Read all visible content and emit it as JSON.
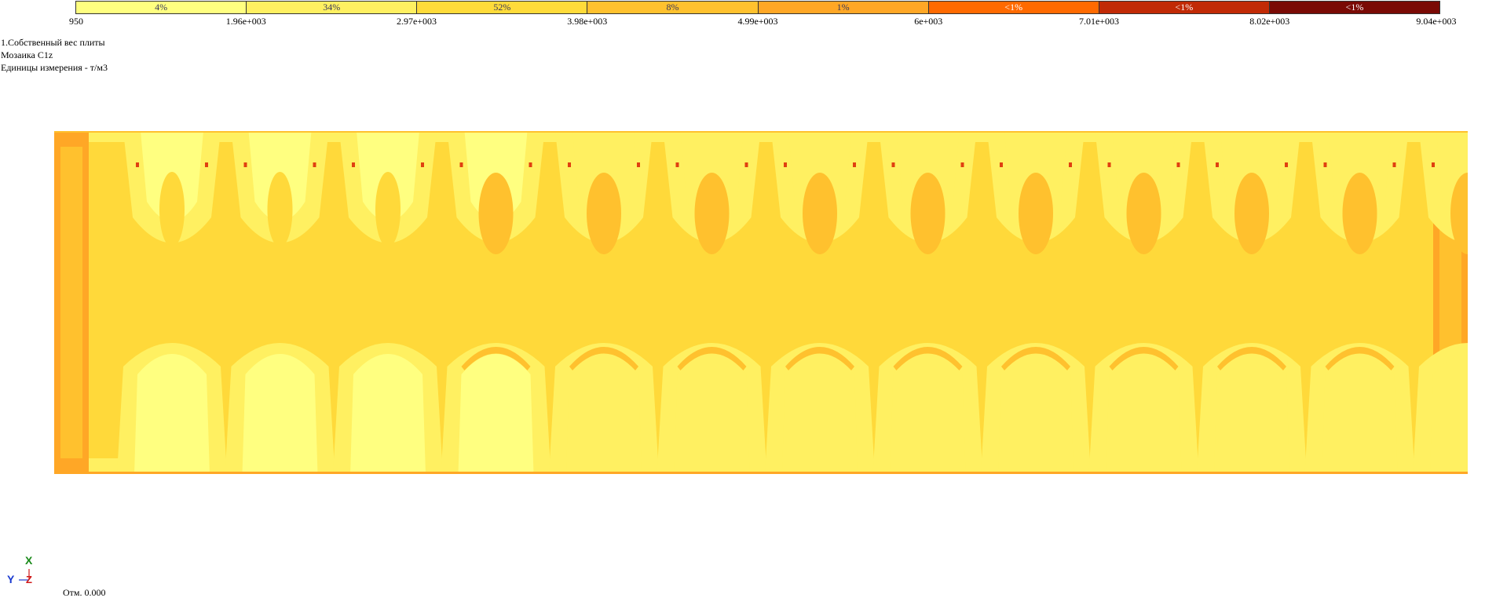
{
  "legend": {
    "segments": [
      {
        "percent": "4%",
        "color": "#FFFF80",
        "text_color": "#3a3a5a"
      },
      {
        "percent": "34%",
        "color": "#FFF061",
        "text_color": "#3a3a5a"
      },
      {
        "percent": "52%",
        "color": "#FFDB3A",
        "text_color": "#3a3a5a"
      },
      {
        "percent": "8%",
        "color": "#FFC12E",
        "text_color": "#3a3a5a"
      },
      {
        "percent": "1%",
        "color": "#FFA726",
        "text_color": "#3a3a5a"
      },
      {
        "percent": "<1%",
        "color": "#FF6A00",
        "text_color": "#ffffff"
      },
      {
        "percent": "<1%",
        "color": "#C12A06",
        "text_color": "#ffffff"
      },
      {
        "percent": "<1%",
        "color": "#7A0A05",
        "text_color": "#ffffff"
      }
    ],
    "ticks": [
      "950",
      "1.96e+003",
      "2.97e+003",
      "3.98e+003",
      "4.99e+003",
      "6e+003",
      "7.01e+003",
      "8.02e+003",
      "9.04e+003"
    ]
  },
  "info": {
    "line1": "1.Собственный вес плиты",
    "line2": "Мозаика C1z",
    "line3": "Единицы измерения - т/м3"
  },
  "plate": {
    "base_color": "#FFD93A",
    "edge_color": "#FFA726",
    "light_color": "#FFF061",
    "lighter_color": "#FFFF80",
    "dark_color": "#FFC12E",
    "hot_color": "#E04010"
  },
  "axis": {
    "x_label": "X",
    "y_label": "Y",
    "z_label": "Z",
    "x_color": "#1a8a1a",
    "y_color": "#1a3ad0",
    "z_color": "#d01a1a"
  },
  "elevation": "Отм. 0.000"
}
